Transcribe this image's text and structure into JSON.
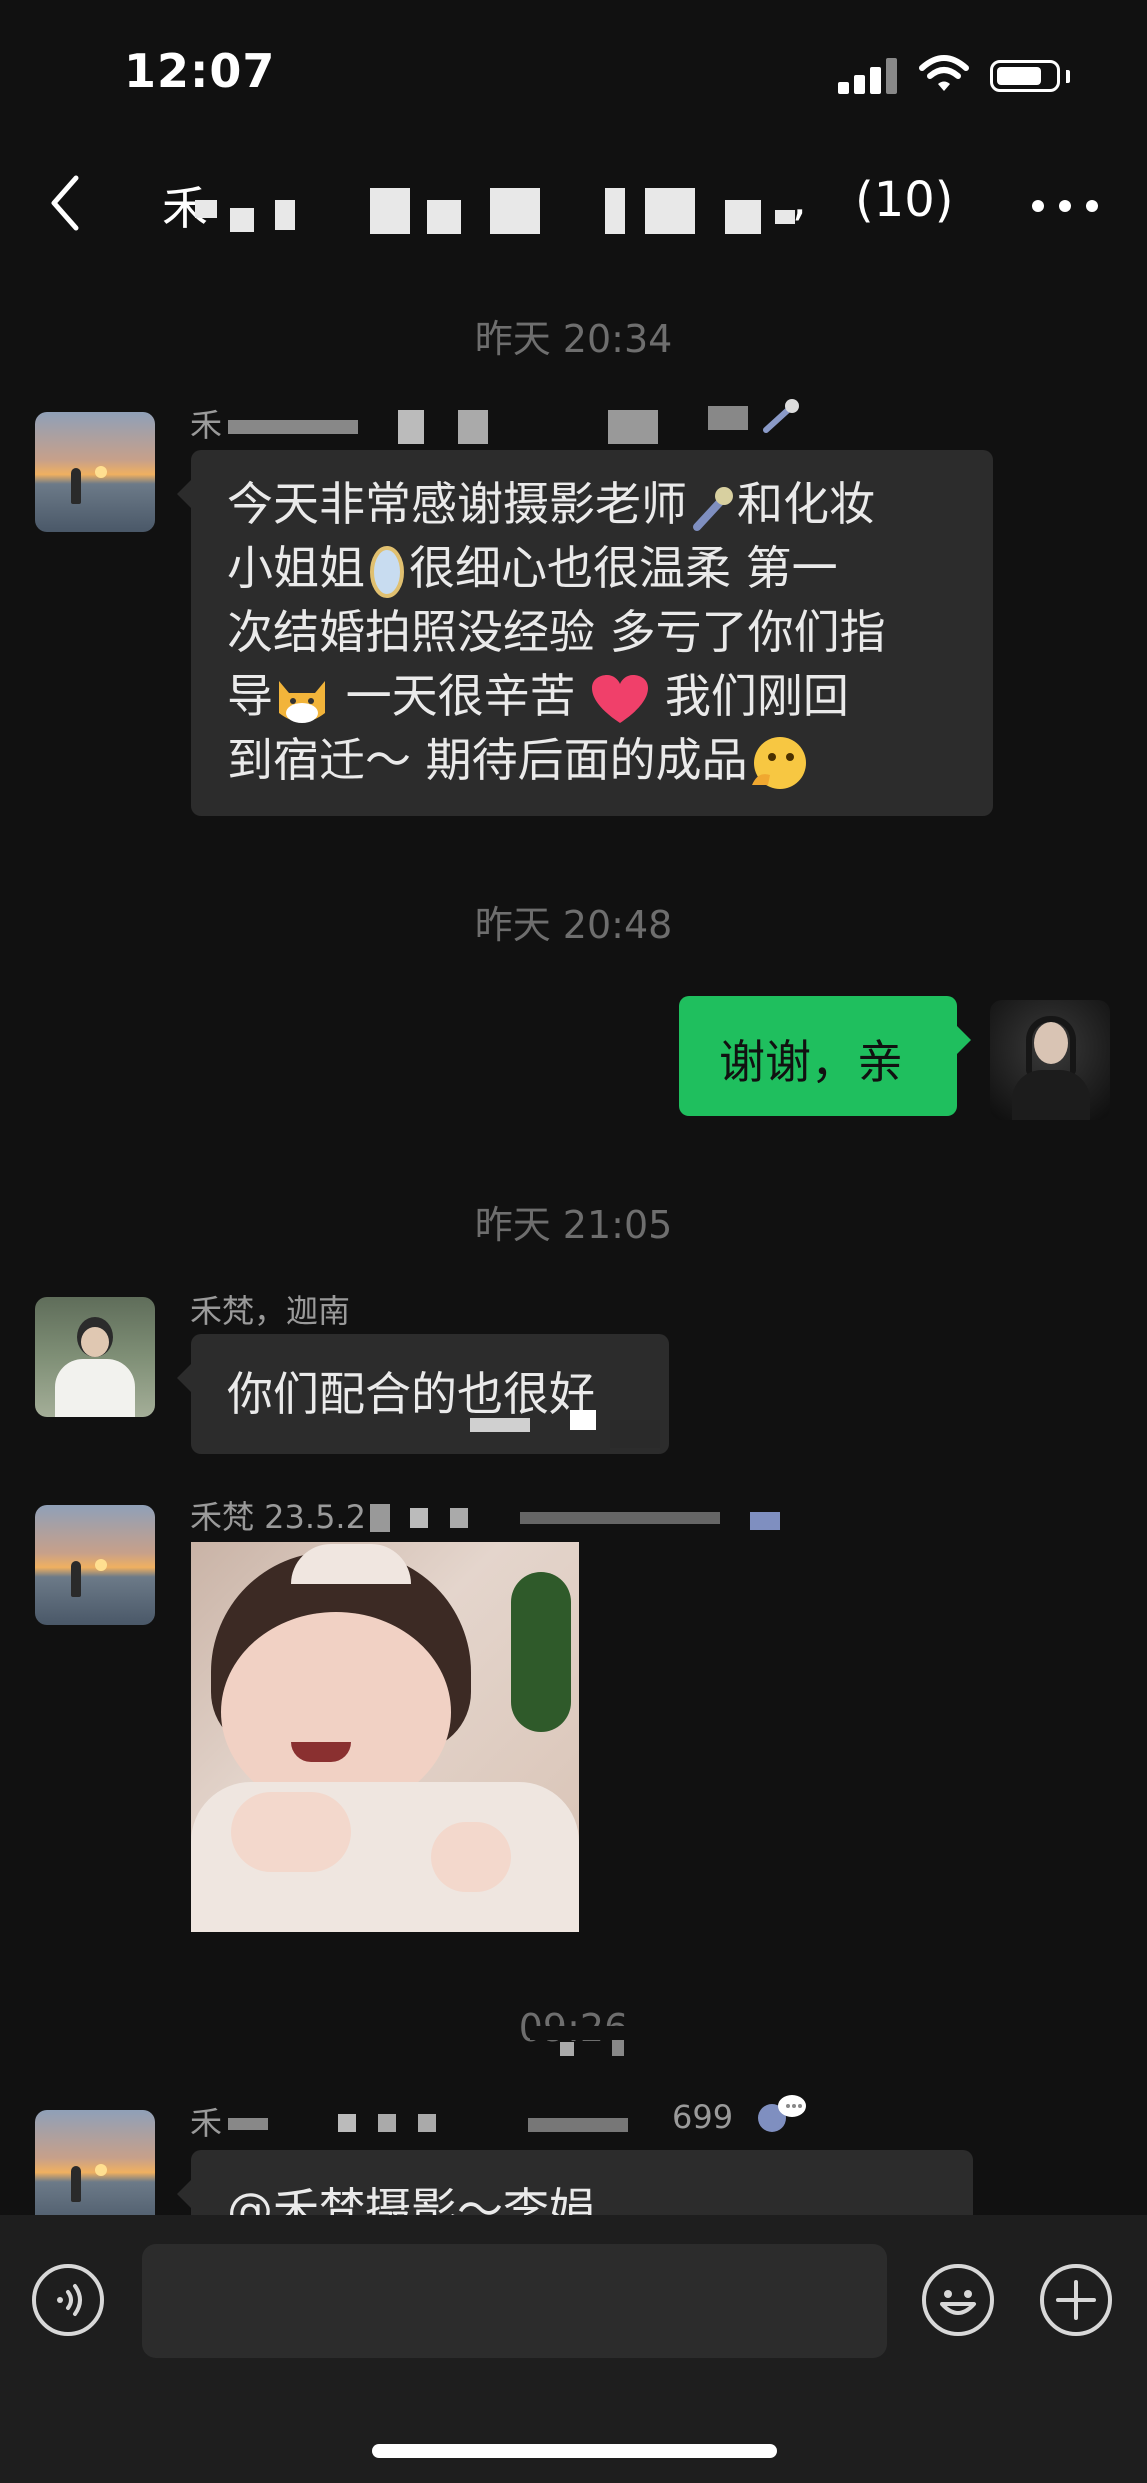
{
  "status_bar": {
    "time": "12:07"
  },
  "header": {
    "title_visible": "禾",
    "title_end": ",",
    "member_count": "(10)"
  },
  "messages": {
    "ts1": "昨天 20:34",
    "m1": {
      "sender_visible": "禾",
      "lines": [
        [
          "今天非常感谢摄影老师",
          "和化妆"
        ],
        [
          "小姐姐",
          "很细心也很温柔 第一"
        ],
        [
          "次结婚拍照没经验 多亏了你们指"
        ],
        [
          "导",
          " 一天很辛苦 ",
          " 我们刚回"
        ],
        [
          "到宿迁～ 期待后面的成品"
        ]
      ]
    },
    "ts2": "昨天 20:48",
    "m2": {
      "text": "谢谢，亲"
    },
    "ts3": "昨天 21:05",
    "m3": {
      "sender": "禾梵，迦南",
      "text": "你们配合的也很好"
    },
    "m4": {
      "sender_visible": "禾梵 23.5.2"
    },
    "ts4": "09:26",
    "m5": {
      "sender_visible": "禾",
      "sender_tail": "699",
      "text": "@禾梵摄影～李娟"
    }
  },
  "input": {
    "placeholder": ""
  },
  "icons": {
    "back": "chevron-left-icon",
    "more": "more-dots-icon",
    "voice": "voice-icon",
    "emoji": "emoji-icon",
    "plus": "plus-icon"
  },
  "colors": {
    "background": "#111111",
    "bubble_in": "#2c2c2c",
    "bubble_out": "#1fbf5e"
  }
}
